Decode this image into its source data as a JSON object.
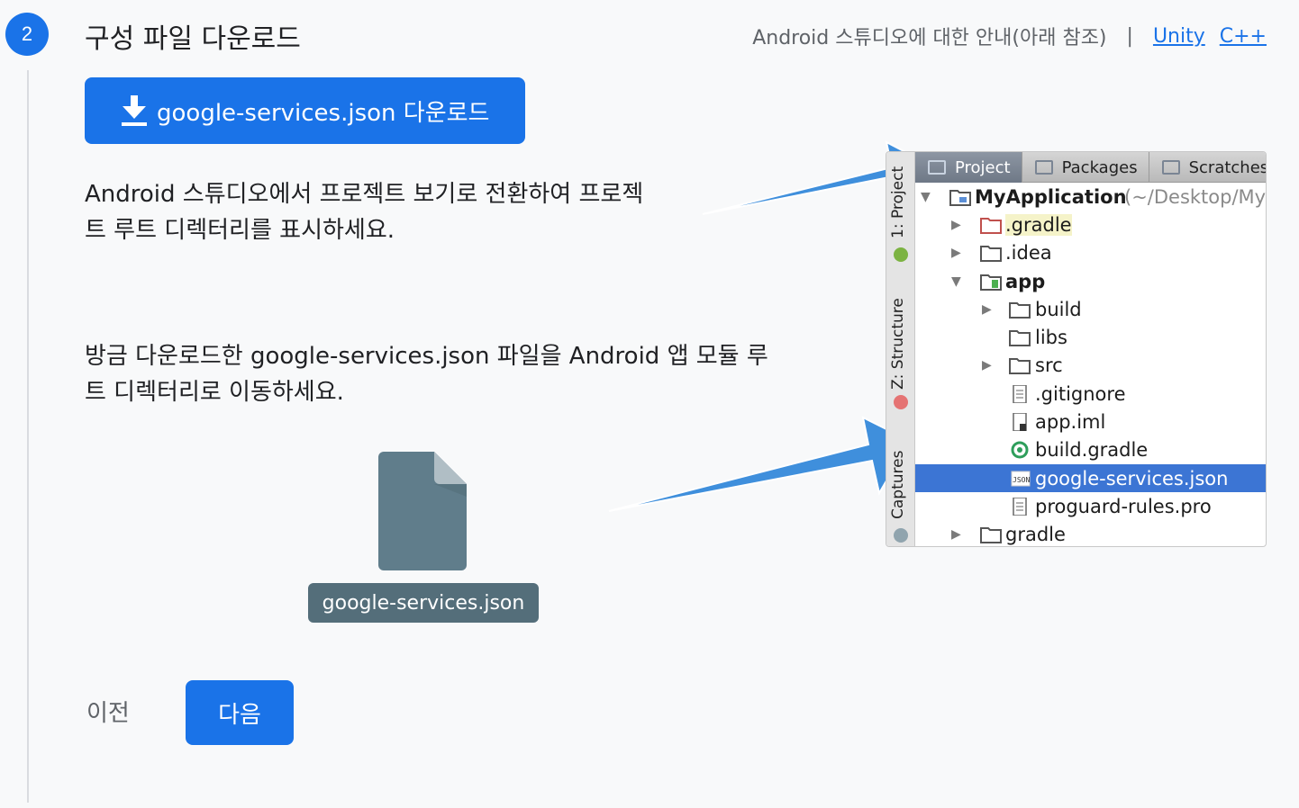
{
  "step": {
    "number": "2",
    "title": "구성 파일 다운로드"
  },
  "top_links": {
    "guide_text": "Android 스튜디오에 대한 안내(아래 참조)",
    "separator": "|",
    "unity": "Unity",
    "cpp": "C++"
  },
  "download_button": {
    "label": "google-services.json 다운로드",
    "icon": "download-icon"
  },
  "instructions": {
    "switch_view": "Android 스튜디오에서 프로젝트 보기로 전환하여 프로젝트 루트 디렉터리를 표시하세요.",
    "move_file": "방금 다운로드한 google-services.json 파일을 Android 앱 모듈 루트 디렉터리로 이동하세요."
  },
  "file_preview": {
    "filename": "google-services.json",
    "icon": "file-icon"
  },
  "navigation": {
    "previous": "이전",
    "next": "다음"
  },
  "ide": {
    "tabs": [
      "Project",
      "Packages",
      "Scratches"
    ],
    "side_labels": [
      "1: Project",
      "Z: Structure",
      "Captures"
    ],
    "tree": [
      {
        "label": "MyApplication",
        "suffix": "(~/Desktop/My",
        "bold": true
      },
      {
        "label": ".gradle"
      },
      {
        "label": ".idea"
      },
      {
        "label": "app",
        "bold": true
      },
      {
        "label": "build"
      },
      {
        "label": "libs"
      },
      {
        "label": "src"
      },
      {
        "label": ".gitignore"
      },
      {
        "label": "app.iml"
      },
      {
        "label": "build.gradle"
      },
      {
        "label": "google-services.json",
        "selected": true
      },
      {
        "label": "proguard-rules.pro"
      },
      {
        "label": "gradle"
      }
    ]
  },
  "colors": {
    "primary": "#1a73e8",
    "chip": "#546e7a",
    "arrow": "#3f8fdc",
    "selection": "#3c75d4"
  }
}
